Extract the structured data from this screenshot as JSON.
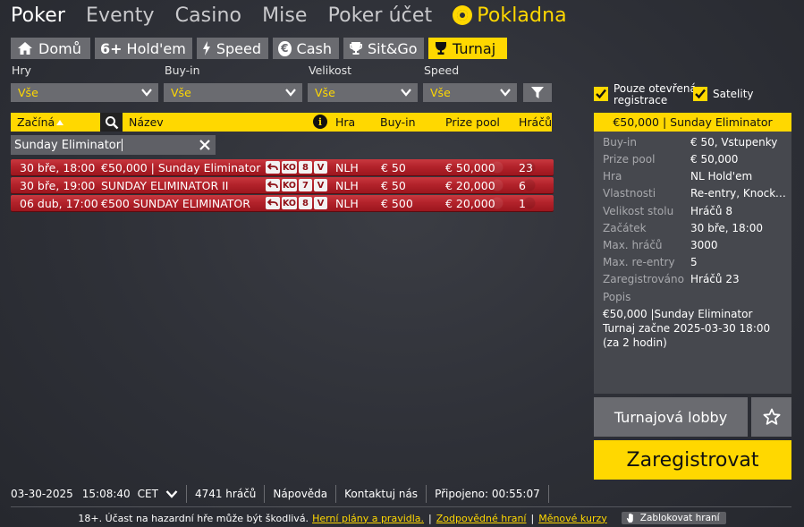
{
  "nav": {
    "items": [
      "Poker",
      "Eventy",
      "Casino",
      "Mise",
      "Poker účet"
    ],
    "cashier": "Pokladna",
    "accent": "#ffd800"
  },
  "tabs": [
    {
      "label": "Domů",
      "icon": "home-icon"
    },
    {
      "label": "Hold'em",
      "icon": "six-plus-icon",
      "icon_text": "6+"
    },
    {
      "label": "Speed",
      "icon": "lightning-icon"
    },
    {
      "label": "Cash",
      "icon": "euro-icon",
      "icon_text": "€"
    },
    {
      "label": "Sit&Go",
      "icon": "trophy-icon"
    },
    {
      "label": "Turnaj",
      "icon": "cup-icon",
      "active": true
    }
  ],
  "filters": {
    "games": {
      "label": "Hry",
      "value": "Vše"
    },
    "buyin": {
      "label": "Buy-in",
      "value": "Vše"
    },
    "size": {
      "label": "Velikost",
      "value": "Vše"
    },
    "speed": {
      "label": "Speed",
      "value": "Vše"
    }
  },
  "checkboxes": {
    "open_registration": {
      "label_line1": "Pouze otevřená",
      "label_line2": "registrace",
      "checked": true
    },
    "satellites": {
      "label": "Satelity",
      "checked": true
    }
  },
  "table": {
    "headers": {
      "start": "Začíná",
      "name": "Název",
      "game": "Hra",
      "buyin": "Buy-in",
      "prize": "Prize pool",
      "players": "Hráčů"
    },
    "search_value": "Sunday Eliminator",
    "rows": [
      {
        "start": "30 bře, 18:00",
        "name": "€50,000 | Sunday Eliminator",
        "ko": "KO",
        "size": "8",
        "speed": "V",
        "game": "NLH",
        "buyin": "€ 50",
        "prize": "€ 50,000",
        "players": "23"
      },
      {
        "start": "30 bře, 19:00",
        "name": "SUNDAY ELIMINATOR II",
        "ko": "KO",
        "size": "7",
        "speed": "V",
        "game": "NLH",
        "buyin": "€ 50",
        "prize": "€ 20,000",
        "players": "6"
      },
      {
        "start": "06 dub, 17:00",
        "name": "€500 SUNDAY ELIMINATOR",
        "ko": "KO",
        "size": "8",
        "speed": "V",
        "game": "NLH",
        "buyin": "€ 500",
        "prize": "€ 20,000",
        "players": "1"
      }
    ]
  },
  "details": {
    "title": "€50,000  |  Sunday Eliminator",
    "rows": [
      {
        "key": "Buy-in",
        "value": "€ 50, Vstupenky"
      },
      {
        "key": "Prize pool",
        "value": "€ 50,000"
      },
      {
        "key": "Hra",
        "value": "NL Hold'em"
      },
      {
        "key": "Vlastnosti",
        "value": "Re-entry, Knockout"
      },
      {
        "key": "Velikost stolu",
        "value": "Hráčů 8"
      },
      {
        "key": "Začátek",
        "value": "30 bře, 18:00"
      },
      {
        "key": "Max. hráčů",
        "value": "3000"
      },
      {
        "key": "Max. re-entry",
        "value": "5"
      },
      {
        "key": "Zaregistrováno",
        "value": "Hráčů 23"
      }
    ],
    "description_label": "Popis",
    "description_line1": "€50,000  |Sunday Eliminator",
    "description_line2": "Turnaj začne 2025-03-30 18:00 (za 2 hodin)",
    "lobby_button": "Turnajová lobby",
    "register_button": "Zaregistrovat"
  },
  "status": {
    "date": "03-30-2025",
    "time": "15:08:40",
    "timezone": "CET",
    "players": "4741 hráčů",
    "help": "Nápověda",
    "contact": "Kontaktuj nás",
    "connected": "Připojeno: 00:55:07"
  },
  "footer": {
    "warning": "18+. Účast na hazardní hře může být škodlivá.",
    "link1": "Herní plány a pravidla.",
    "link2": "Zodpovědné hraní",
    "link3": "Měnové kurzy",
    "block_button": "Zablokovat hraní"
  }
}
